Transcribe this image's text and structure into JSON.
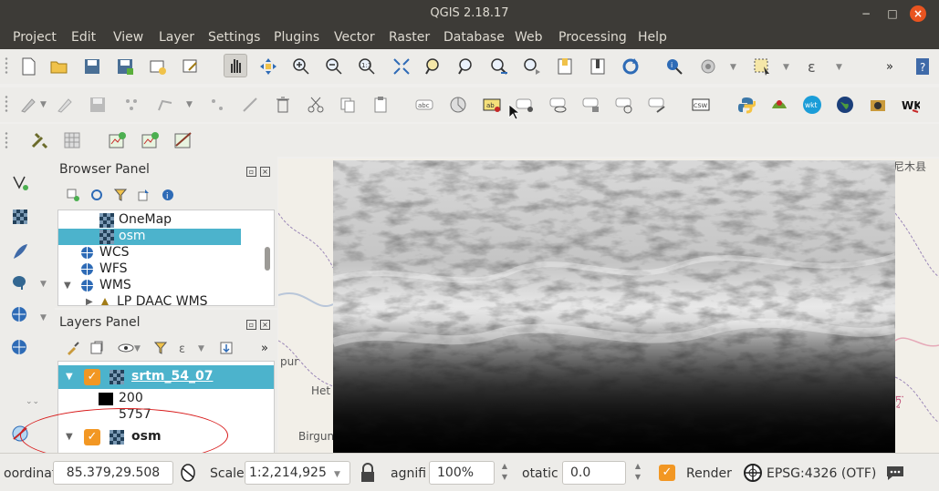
{
  "window": {
    "title": "QGIS 2.18.17",
    "minimize_glyph": "−",
    "maximize_glyph": "□",
    "close_glyph": "×"
  },
  "menu": [
    "Project",
    "Edit",
    "View",
    "Layer",
    "Settings",
    "Plugins",
    "Vector",
    "Raster",
    "Database",
    "Web",
    "Processing",
    "Help"
  ],
  "toolbar_overflow": "»",
  "toolbar_labels": {
    "abc": "abc",
    "ab": "ab",
    "csw": "CSW",
    "wkt": "wkt",
    "wkt2": "WKT"
  },
  "browser_panel": {
    "title": "Browser Panel",
    "items": [
      {
        "label": "OneMap",
        "icon": "raster-icon"
      },
      {
        "label": "osm",
        "icon": "raster-icon",
        "selected": true
      },
      {
        "label": "WCS",
        "icon": "globe-icon"
      },
      {
        "label": "WFS",
        "icon": "globe-icon"
      },
      {
        "label": "WMS",
        "icon": "globe-icon",
        "expanded": true
      },
      {
        "label": "LP DAAC WMS",
        "icon": "wms-server-icon"
      }
    ]
  },
  "layers_panel": {
    "title": "Layers Panel",
    "overflow": "»",
    "layers": [
      {
        "name": "srtm_54_07",
        "checked": true,
        "selected": true,
        "legend": [
          "200",
          "5757"
        ]
      },
      {
        "name": "osm",
        "checked": true,
        "selected": false
      }
    ]
  },
  "map": {
    "labels": [
      "尼木县",
      "pur",
      "Het",
      "Birgun"
    ]
  },
  "statusbar": {
    "coordinate_label": "oordinat",
    "coordinate_value": "85.379,29.508",
    "scale_label": "Scale",
    "scale_value": "1:2,214,925",
    "magnifier_label": "agnifi",
    "magnifier_value": "100%",
    "rotation_label": "otatic",
    "rotation_value": "0.0",
    "render_label": "Render",
    "render_checked": true,
    "crs": "EPSG:4326 (OTF)"
  },
  "colors": {
    "titlebar": "#3d3b37",
    "selection": "#4cb3cc",
    "checkbox": "#f29723",
    "close": "#e95420",
    "annotation": "#d81b1b"
  }
}
